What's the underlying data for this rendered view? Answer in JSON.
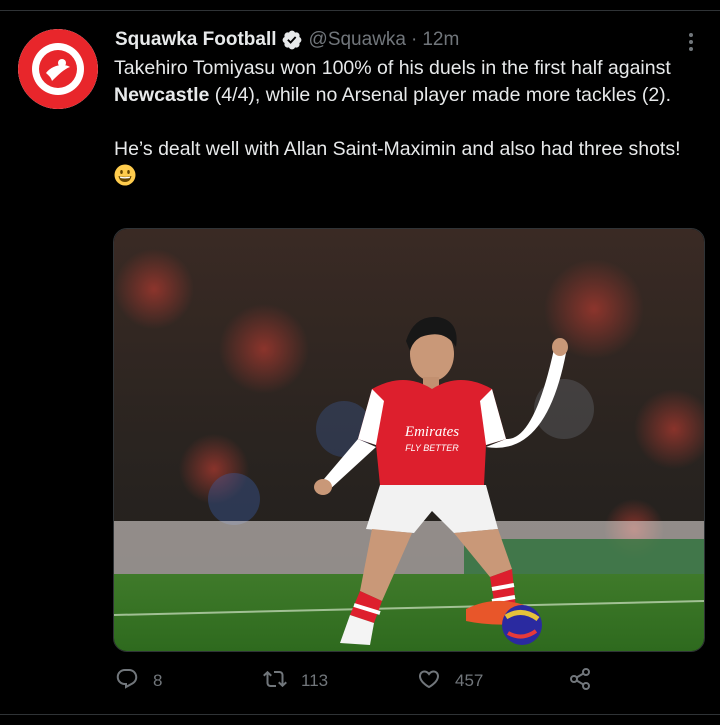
{
  "tweet": {
    "author_name": "Squawka Football",
    "author_handle": "@Squawka",
    "separator": "·",
    "timestamp": "12m",
    "text_part1": "Takehiro Tomiyasu won 100% of his duels in the first half against ",
    "text_bold": "Newcastle",
    "text_part2": " (4/4), while no Arsenal player made more tackles (2).",
    "text_para2": "He’s dealt well with Allan Saint-Maximin and also had three shots! ",
    "emoji": "grinning-face-emoji",
    "media_alt": "Takehiro Tomiyasu in an Arsenal kit controlling the ball",
    "kit_sponsor_line1": "Emirates",
    "kit_sponsor_line2": "FLY BETTER"
  },
  "actions": {
    "reply_count": "8",
    "retweet_count": "113",
    "like_count": "457"
  },
  "colors": {
    "background": "#000000",
    "text": "#e7e9ea",
    "secondary": "#71767b",
    "verified": "#1d9bf0",
    "avatar_red": "#e8262b"
  },
  "icons": [
    "verified-badge-icon",
    "more-options-icon",
    "reply-icon",
    "retweet-icon",
    "like-icon",
    "share-icon"
  ]
}
